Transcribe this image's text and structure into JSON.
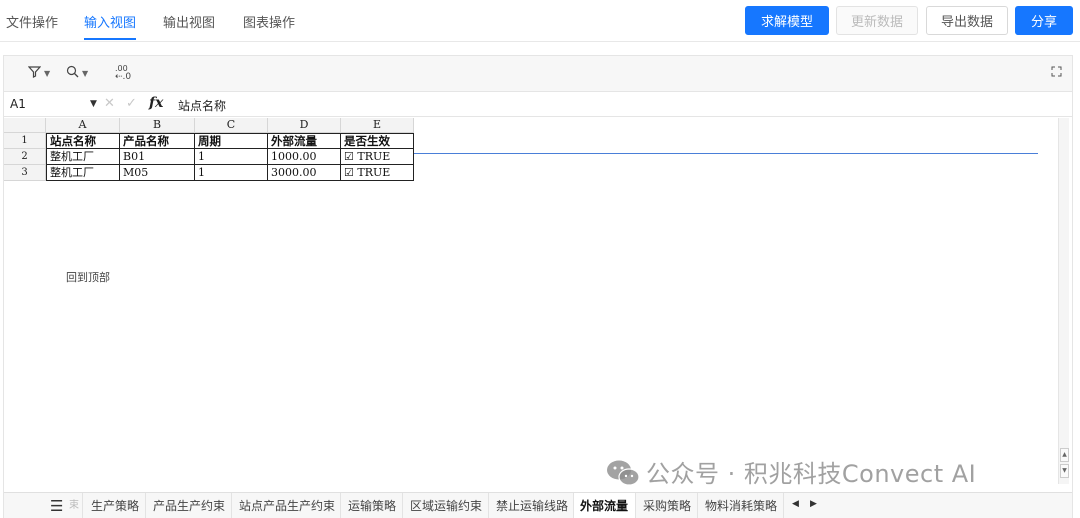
{
  "nav": {
    "tabs": [
      {
        "label": "文件操作"
      },
      {
        "label": "输入视图"
      },
      {
        "label": "输出视图"
      },
      {
        "label": "图表操作"
      }
    ],
    "active_tab": "输入视图"
  },
  "actions": {
    "solve_label": "求解模型",
    "update_label": "更新数据",
    "export_label": "导出数据",
    "share_label": "分享"
  },
  "toolbar": {
    "icons": [
      "filter-icon",
      "search-icon",
      "decimal-format-icon",
      "expand-icon"
    ],
    "decimal_glyph": ".00"
  },
  "formula_bar": {
    "cell_ref": "A1",
    "fx_label": "fx",
    "value": "站点名称"
  },
  "grid": {
    "columns": [
      "A",
      "B",
      "C",
      "D",
      "E"
    ],
    "rows": [
      "1",
      "2",
      "3"
    ],
    "header": [
      "站点名称",
      "产品名称",
      "周期",
      "外部流量",
      "是否生效"
    ],
    "data": [
      [
        "整机工厂",
        "B01",
        "1",
        "1000.00",
        "☑ TRUE"
      ],
      [
        "整机工厂",
        "M05",
        "1",
        "3000.00",
        "☑ TRUE"
      ]
    ],
    "back_to_top": "回到顶部"
  },
  "sheet_tabs": {
    "partial_label": "束",
    "tabs": [
      "生产策略",
      "产品生产约束",
      "站点产品生产约束",
      "运输策略",
      "区域运输约束",
      "禁止运输线路",
      "外部流量",
      "采购策略",
      "物料消耗策略"
    ],
    "active": "外部流量"
  },
  "watermark": {
    "text": "公众号 · 积兆科技Convect AI"
  },
  "colors": {
    "accent": "#1677ff",
    "selection": "#4a7fd8"
  }
}
